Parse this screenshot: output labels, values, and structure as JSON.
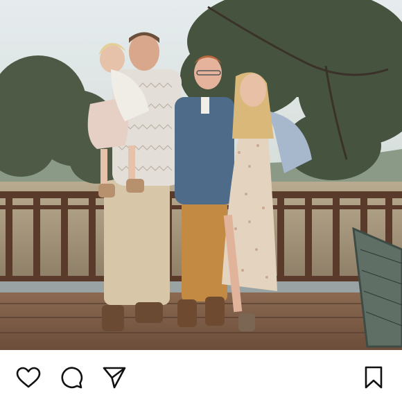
{
  "post": {
    "actions": {
      "like_icon": "heart-icon",
      "comment_icon": "comment-bubble-icon",
      "share_icon": "paper-plane-icon",
      "save_icon": "bookmark-icon"
    }
  },
  "colors": {
    "sky": "#dfe7ea",
    "foliage": "#4f5b44",
    "deck": "#7a5a44",
    "railing": "#5a3a2a",
    "icon_stroke": "#111111"
  }
}
